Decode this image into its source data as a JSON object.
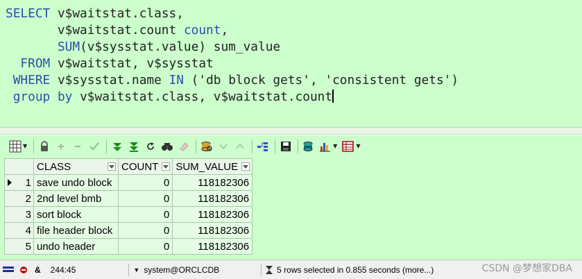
{
  "editor": {
    "sql": {
      "l1_kw": "SELECT",
      "l1_rest": " v$waitstat.class,",
      "l2": "       v$waitstat.count ",
      "l2_alias": "count",
      "l2_end": ",",
      "l3_kw": "SUM",
      "l3_rest": "(v$sysstat.value) sum_value",
      "l4_kw": "FROM",
      "l4_rest": " v$waitstat, v$sysstat",
      "l5_kw": "WHERE",
      "l5_mid": " v$sysstat.name ",
      "l5_in": "IN",
      "l5_rest": " ('db block gets', 'consistent gets')",
      "l6_kw": "group by",
      "l6_rest": " v$waitstat.class, v$waitstat.count"
    }
  },
  "toolbar": {
    "icons": [
      "grid-menu-icon",
      "lock-icon",
      "add-record-icon",
      "delete-record-icon",
      "post-changes-icon",
      "fetch-next-icon",
      "fetch-last-icon",
      "refresh-icon",
      "find-icon",
      "clear-icon",
      "query-by-example-icon",
      "next-record-icon",
      "previous-record-icon",
      "explain-plan-icon",
      "save-icon",
      "export-icon",
      "chart-icon",
      "single-record-view-icon"
    ]
  },
  "results": {
    "columns": [
      "CLASS",
      "COUNT",
      "SUM_VALUE"
    ],
    "rows": [
      {
        "n": "1",
        "class": "save undo block",
        "count": "0",
        "sum_value": "118182306"
      },
      {
        "n": "2",
        "class": "2nd level bmb",
        "count": "0",
        "sum_value": "118182306"
      },
      {
        "n": "3",
        "class": "sort block",
        "count": "0",
        "sum_value": "118182306"
      },
      {
        "n": "4",
        "class": "file header block",
        "count": "0",
        "sum_value": "118182306"
      },
      {
        "n": "5",
        "class": "undo header",
        "count": "0",
        "sum_value": "118182306"
      }
    ],
    "current_row": 1
  },
  "status": {
    "position": "244:45",
    "connection": "system@ORCLCDB",
    "message": "5 rows selected in 0.855 seconds (more...)"
  },
  "watermark": "CSDN @梦想家DBA",
  "colors": {
    "editor_bg": "#ccffcc",
    "keyword": "#2a4ea8",
    "grid_cell": "#e4fbe4"
  }
}
